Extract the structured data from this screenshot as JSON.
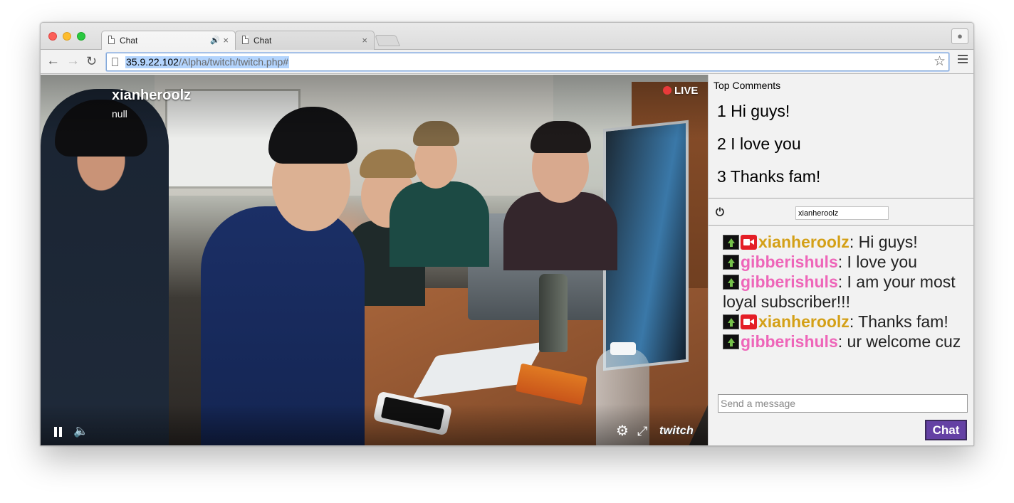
{
  "browser": {
    "tabs": [
      {
        "title": "Chat",
        "audio_icon": "speaker-icon",
        "close": "×"
      },
      {
        "title": "Chat",
        "close": "×"
      }
    ],
    "url_host": "35.9.22.102",
    "url_path": "/Alpha/twitch/twitch.php#",
    "nav": {
      "back": "←",
      "forward": "→",
      "reload": "↻",
      "star": "☆",
      "profile": "👤"
    }
  },
  "player": {
    "channel_name": "xianheroolz",
    "status": "null",
    "live_label": "LIVE",
    "brand": "twitch",
    "controls": [
      "pause-icon",
      "volume-icon",
      "gear-icon",
      "fullscreen-icon"
    ],
    "icons": {
      "volume": "🔈",
      "gear": "⚙",
      "fullscreen": "⤢"
    }
  },
  "top_comments": {
    "heading": "Top Comments",
    "items": [
      "1 Hi guys!",
      "2 I love you",
      "3 Thanks fam!"
    ]
  },
  "chat": {
    "power_icon": "⏻",
    "username": "xianheroolz",
    "colors": {
      "xianheroolz": "#d4a017",
      "gibberishuls": "#ee66b9"
    },
    "messages": [
      {
        "user": "xianheroolz",
        "text": ": Hi guys!",
        "broadcaster": true
      },
      {
        "user": "gibberishuls",
        "text": ": I love you",
        "broadcaster": false
      },
      {
        "user": "gibberishuls",
        "text": ": I am your most loyal subscriber!!!",
        "broadcaster": false
      },
      {
        "user": "xianheroolz",
        "text": ": Thanks fam!",
        "broadcaster": true
      },
      {
        "user": "gibberishuls",
        "text": ": ur welcome cuz",
        "broadcaster": false
      }
    ],
    "input_placeholder": "Send a message",
    "send_label": "Chat",
    "accent": "#6441a4"
  }
}
